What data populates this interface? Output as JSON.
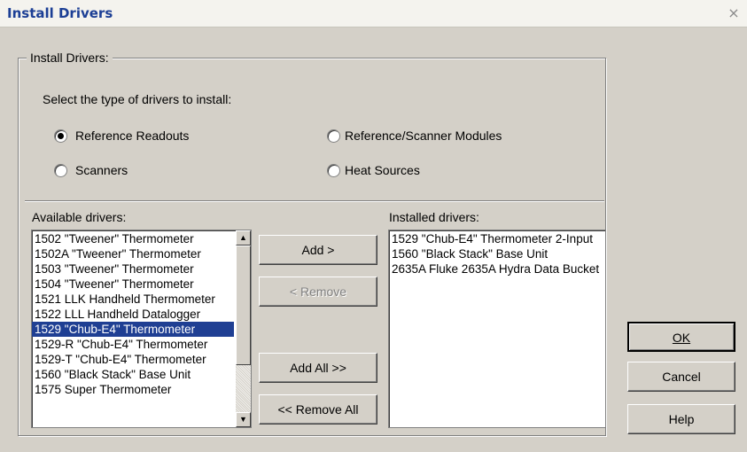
{
  "window": {
    "title": "Install Drivers",
    "close_glyph": "×"
  },
  "group": {
    "legend": "Install Drivers:",
    "prompt": "Select the type of drivers to install:",
    "options": [
      {
        "label": "Reference Readouts",
        "selected": true
      },
      {
        "label": "Reference/Scanner Modules",
        "selected": false
      },
      {
        "label": "Scanners",
        "selected": false
      },
      {
        "label": "Heat Sources",
        "selected": false
      }
    ]
  },
  "available": {
    "label": "Available drivers:",
    "items": [
      "1502 \"Tweener\" Thermometer",
      "1502A \"Tweener\" Thermometer",
      "1503 \"Tweener\" Thermometer",
      "1504 \"Tweener\" Thermometer",
      "1521 LLK Handheld Thermometer",
      "1522 LLL Handheld Datalogger",
      "1529 \"Chub-E4\" Thermometer",
      "1529-R \"Chub-E4\" Thermometer",
      "1529-T \"Chub-E4\" Thermometer",
      "1560 \"Black Stack\" Base Unit",
      "1575 Super Thermometer"
    ],
    "selected_index": 6
  },
  "installed": {
    "label": "Installed drivers:",
    "items": [
      "1529 \"Chub-E4\" Thermometer 2-Input",
      "1560 \"Black Stack\" Base Unit",
      "2635A Fluke 2635A Hydra Data Bucket"
    ]
  },
  "buttons": {
    "add": "Add >",
    "remove": "< Remove",
    "add_all": "Add All >>",
    "remove_all": "<< Remove All",
    "ok": "OK",
    "cancel": "Cancel",
    "help": "Help"
  }
}
